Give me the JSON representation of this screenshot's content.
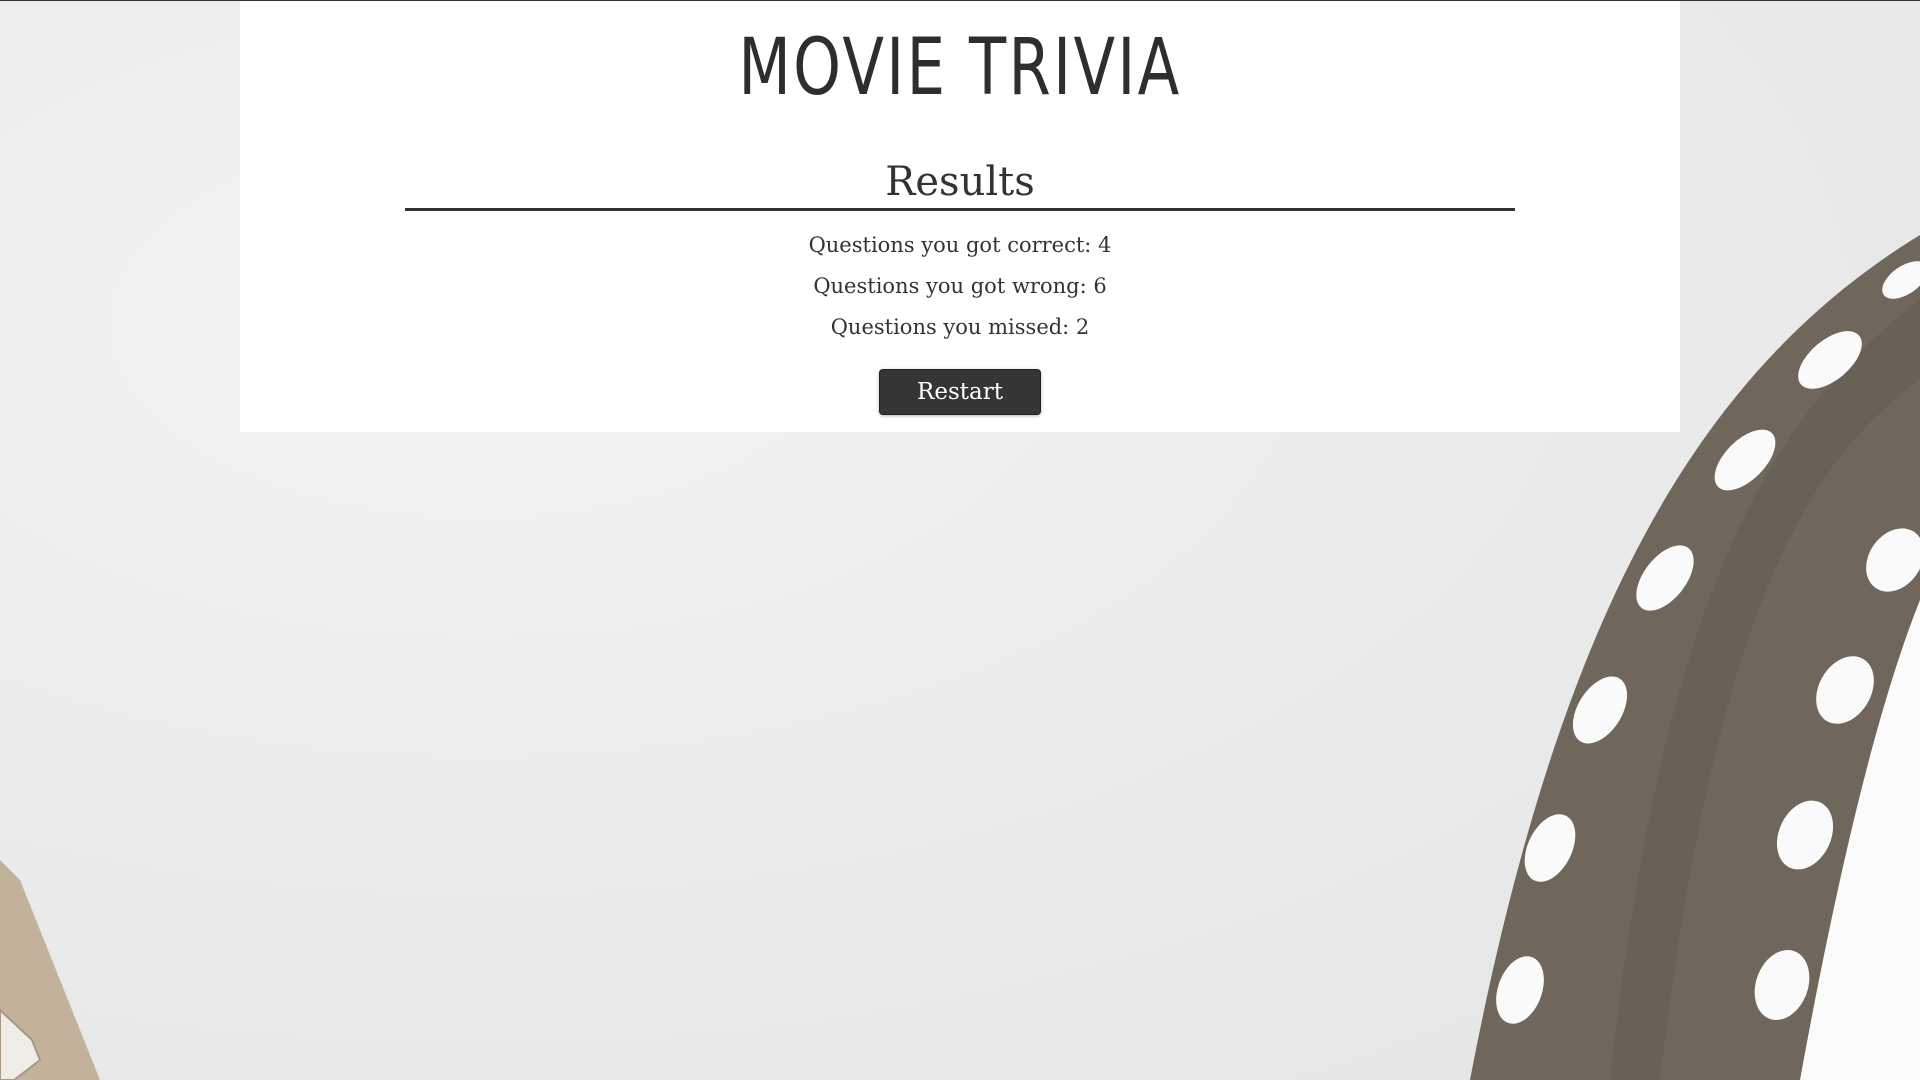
{
  "header": {
    "title": "MOVIE TRIVIA"
  },
  "results": {
    "heading": "Results",
    "correct_label": "Questions you got correct: 4",
    "wrong_label": "Questions you got wrong: 6",
    "missed_label": "Questions you missed: 2",
    "correct_count": 4,
    "wrong_count": 6,
    "missed_count": 2
  },
  "actions": {
    "restart_label": "Restart"
  },
  "background": {
    "image_subject": "film-reel-icon",
    "colors": {
      "page_bg": "#ebebeb",
      "panel_bg": "#ffffff",
      "film_strip": "#6f665c",
      "film_strip_left": "#c2b29c",
      "button_bg": "#353535",
      "text": "#333333"
    }
  }
}
